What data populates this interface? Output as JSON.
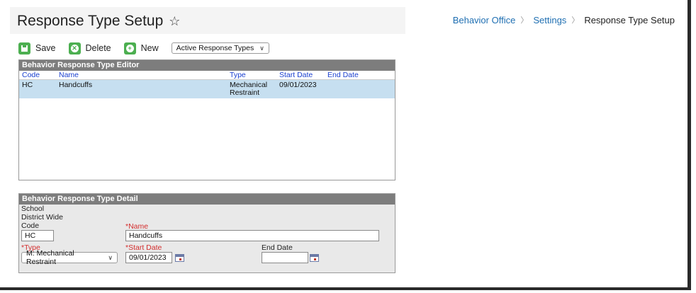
{
  "header": {
    "title": "Response Type Setup",
    "star_icon": "star-outline-icon",
    "breadcrumb": [
      "Behavior Office",
      "Settings",
      "Response Type Setup"
    ]
  },
  "toolbar": {
    "save_label": "Save",
    "delete_label": "Delete",
    "new_label": "New",
    "filter_value": "Active Response Types"
  },
  "editor": {
    "title": "Behavior Response Type Editor",
    "columns": {
      "code": "Code",
      "name": "Name",
      "type": "Type",
      "start": "Start Date",
      "end": "End Date"
    },
    "rows": [
      {
        "code": "HC",
        "name": "Handcuffs",
        "type_line1": "Mechanical",
        "type_line2": "Restraint",
        "start": "09/01/2023",
        "end": ""
      }
    ]
  },
  "detail": {
    "title": "Behavior Response Type Detail",
    "school_label": "School",
    "school_value": "District Wide",
    "code_label": "Code",
    "code_value": "HC",
    "name_label": "*Name",
    "name_value": "Handcuffs",
    "type_label": "*Type",
    "type_value": "M: Mechanical Restraint",
    "start_label": "*Start Date",
    "start_value": "09/01/2023",
    "end_label": "End Date",
    "end_value": ""
  },
  "colors": {
    "accent": "#4caf50",
    "header_gray": "#7d7d7d",
    "selected_row": "#c6dff0",
    "link": "#1f6fb2",
    "required": "#d32f2f"
  }
}
